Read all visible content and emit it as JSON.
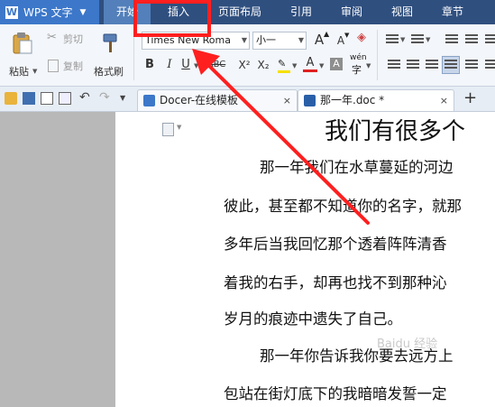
{
  "app": {
    "name": "WPS 文字",
    "logo": "W"
  },
  "menu": {
    "tabs": [
      {
        "label": "开始"
      },
      {
        "label": "插入"
      },
      {
        "label": "页面布局"
      },
      {
        "label": "引用"
      },
      {
        "label": "审阅"
      },
      {
        "label": "视图"
      },
      {
        "label": "章节"
      }
    ],
    "active_tab": "插入"
  },
  "ribbon": {
    "paste_label": "粘贴",
    "cut_label": "剪切",
    "copy_label": "复制",
    "format_painter_label": "格式刷",
    "font_name": "Times New Roma",
    "font_size": "小一",
    "grow_font": "A",
    "shrink_font": "A",
    "bold": "B",
    "italic": "I",
    "underline": "U",
    "strike": "ABC",
    "superscript": "X²",
    "subscript": "X₂",
    "font_color": "A",
    "char_shading": "A",
    "phonetic": "wén",
    "phonetic_char": "字"
  },
  "tabbar": {
    "tabs": [
      {
        "label": "Docer-在线模板",
        "close": "×"
      },
      {
        "label": "那一年.doc *",
        "close": "×"
      }
    ],
    "add": "+"
  },
  "document": {
    "title": "我们有很多个",
    "lines": [
      "那一年我们在水草蔓延的河边",
      "彼此，甚至都不知道你的名字，就那",
      "多年后当我回忆那个透着阵阵清香",
      "着我的右手，却再也找不到那种沁",
      "岁月的痕迹中遗失了自己。",
      "那一年你告诉我你要去远方上",
      "包站在街灯底下的我暗暗发誓一定"
    ],
    "watermark": "Baidu 经验"
  },
  "colors": {
    "titlebar": "#2f4f7f",
    "app_button": "#3c77c9",
    "annotation": "#ff1f1f"
  }
}
